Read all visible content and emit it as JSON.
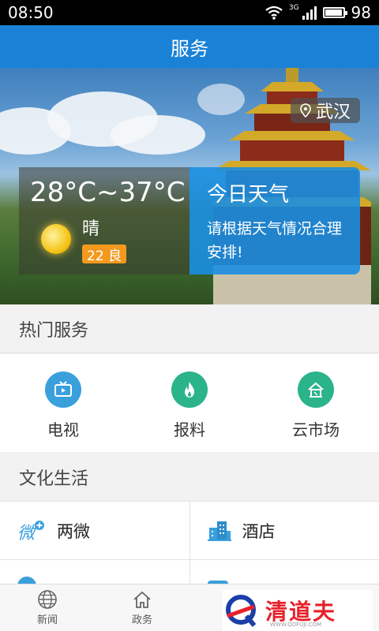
{
  "status_bar": {
    "time": "08:50",
    "network": "3G",
    "battery": "98"
  },
  "title_bar": {
    "title": "服务"
  },
  "hero": {
    "location": "武汉",
    "temperature": "28°C~37°C",
    "condition": "晴",
    "aqi": "22 良",
    "tip_title": "今日天气",
    "tip_text": "请根据天气情况合理安排!"
  },
  "hot_services": {
    "header": "热门服务",
    "items": [
      {
        "label": "电视",
        "icon": "tv-icon",
        "color": "#3aa0dc"
      },
      {
        "label": "报料",
        "icon": "fire-icon",
        "color": "#2bb38a"
      },
      {
        "label": "云市场",
        "icon": "market-icon",
        "color": "#2bb38a"
      }
    ]
  },
  "culture": {
    "header": "文化生活",
    "items": [
      {
        "label": "两微",
        "icon": "weibo-weixin-icon"
      },
      {
        "label": "酒店",
        "icon": "hotel-icon"
      }
    ]
  },
  "bottom_nav": {
    "items": [
      {
        "label": "新闻",
        "icon": "globe-icon"
      },
      {
        "label": "政务",
        "icon": "home-icon"
      }
    ]
  },
  "watermark": {
    "text": "清道夫",
    "sub": "WWW.QDFUJI.COM"
  }
}
